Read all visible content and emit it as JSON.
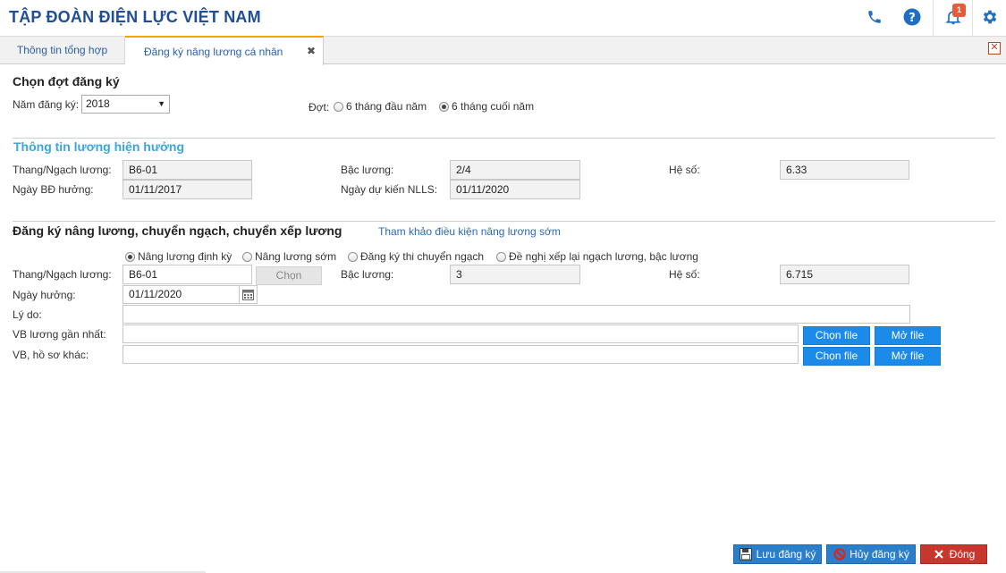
{
  "header": {
    "title": "TẬP ĐOÀN ĐIỆN LỰC VIỆT NAM",
    "notification_count": "1"
  },
  "tabs": [
    {
      "label": "Thông tin tổng hợp"
    },
    {
      "label": "Đăng ký nâng lương cá nhân"
    }
  ],
  "select_period": {
    "title": "Chọn đợt đăng ký",
    "year_label": "Năm đăng ký:",
    "year_value": "2018",
    "period_label": "Đợt:",
    "options": [
      {
        "label": "6 tháng đầu năm",
        "checked": false
      },
      {
        "label": "6 tháng cuối năm",
        "checked": true
      }
    ]
  },
  "current_salary": {
    "title": "Thông tin lương hiện hưởng",
    "rank_label": "Thang/Ngạch lương:",
    "rank_value": "B6-01",
    "level_label": "Bậc lương:",
    "level_value": "2/4",
    "coef_label": "Hệ số:",
    "coef_value": "6.33",
    "start_label": "Ngày BĐ hưởng:",
    "start_value": "01/11/2017",
    "expected_label": "Ngày dự kiến NLLS:",
    "expected_value": "01/11/2020"
  },
  "registration": {
    "title": "Đăng ký nâng lương, chuyển ngạch, chuyển xếp lương",
    "ref_link": "Tham khảo điều kiện nâng lương sớm",
    "types": [
      {
        "label": "Nâng lương định kỳ",
        "checked": true
      },
      {
        "label": "Nâng lương sớm",
        "checked": false
      },
      {
        "label": "Đăng ký thi chuyển ngạch",
        "checked": false
      },
      {
        "label": "Đề nghị xếp lại ngạch lương, bậc lương",
        "checked": false
      }
    ],
    "rank_label": "Thang/Ngạch lương:",
    "rank_value": "B6-01",
    "choose_button": "Chọn",
    "level_label": "Bậc lương:",
    "level_value": "3",
    "coef_label": "Hệ số:",
    "coef_value": "6.715",
    "date_label": "Ngày hưởng:",
    "date_value": "01/11/2020",
    "reason_label": "Lý do:",
    "reason_value": "",
    "doc1_label": "VB lương gần nhất:",
    "doc2_label": "VB, hồ sơ khác:",
    "choose_file": "Chọn file",
    "open_file": "Mở file"
  },
  "footer": {
    "save": "Lưu đăng ký",
    "cancel": "Hủy đăng ký",
    "close": "Đóng"
  },
  "colors": {
    "brand": "#1f4e96",
    "accent": "#1c8ae8",
    "section": "#3aa6dc",
    "danger": "#c8372d"
  }
}
